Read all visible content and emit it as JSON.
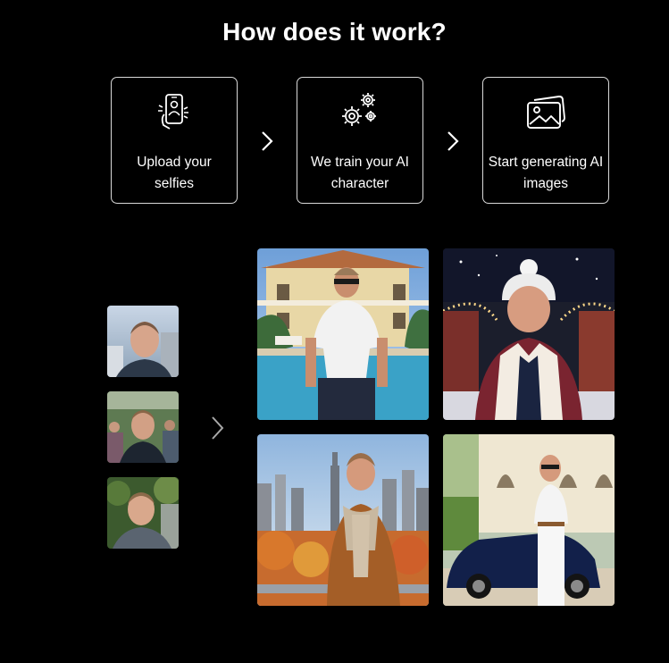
{
  "heading": "How does it work?",
  "steps": [
    {
      "label": "Upload your selfies",
      "icon": "phone-upload-icon"
    },
    {
      "label": "We train your AI character",
      "icon": "gears-icon"
    },
    {
      "label": "Start generating AI images",
      "icon": "image-gallery-icon"
    }
  ],
  "selfies": [
    {
      "description": "selfie-1"
    },
    {
      "description": "selfie-2"
    },
    {
      "description": "selfie-3"
    }
  ],
  "generated_images": [
    {
      "description": "man-by-villa-pool"
    },
    {
      "description": "man-winter-market"
    },
    {
      "description": "man-city-autumn"
    },
    {
      "description": "man-with-sports-car"
    }
  ]
}
